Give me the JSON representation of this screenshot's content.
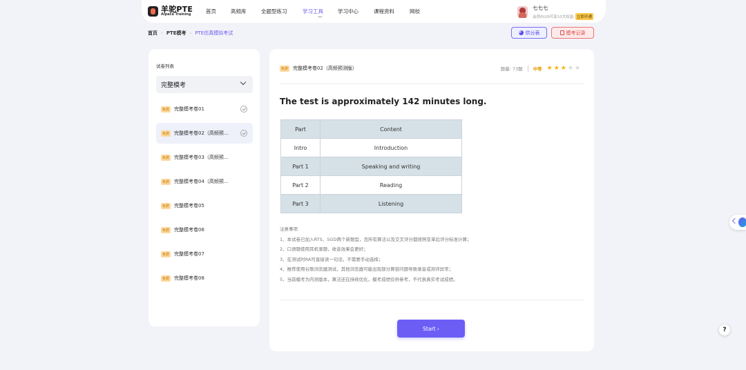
{
  "brand": {
    "title": "羊驼PTE",
    "subtitle": "Alpaca Training"
  },
  "nav": [
    {
      "label": "首页"
    },
    {
      "label": "高频库"
    },
    {
      "label": "全题型练习"
    },
    {
      "label": "学习工具",
      "active": true
    },
    {
      "label": "学习中心"
    },
    {
      "label": "课程资料"
    },
    {
      "label": "网校"
    }
  ],
  "user": {
    "name": "七七七",
    "plus_text": "会员PLUS可享10大权益",
    "open_button": "立即开通"
  },
  "breadcrumb": {
    "home": "首页",
    "section": "PTE模考",
    "current": "PTE仿真模拟考试"
  },
  "actions": {
    "score_table": "供分表",
    "exam_record": "模考记录"
  },
  "sidebar": {
    "title": "试卷列表",
    "select_value": "完整模考",
    "papers": [
      {
        "tag": "免费",
        "label": "完整模考卷01",
        "done": true
      },
      {
        "tag": "免费",
        "label": "完整模考卷02（高频预...",
        "done": true,
        "selected": true
      },
      {
        "tag": "免费",
        "label": "完整模考卷03（高频预..."
      },
      {
        "tag": "免费",
        "label": "完整模考卷04（高频预..."
      },
      {
        "tag": "免费",
        "label": "完整模考卷05"
      },
      {
        "tag": "免费",
        "label": "完整模考卷06"
      },
      {
        "tag": "免费",
        "label": "完整模考卷07"
      },
      {
        "tag": "免费",
        "label": "完整模考卷08"
      }
    ]
  },
  "main": {
    "tag": "免费",
    "paper_title": "完整模考卷02（高频预测版）",
    "question_count": "题量: 73题",
    "level": "中等",
    "rating": {
      "value": 3,
      "max": 5
    },
    "headline": "The test is approximately 142 minutes long.",
    "table": {
      "headers": [
        "Part",
        "Content"
      ],
      "rows": [
        [
          "Intro",
          "Introduction"
        ],
        [
          "Part 1",
          "Speaking and writing"
        ],
        [
          "Part 2",
          "Reading"
        ],
        [
          "Part 3",
          "Listening"
        ]
      ]
    },
    "notes_title": "注意事项",
    "notes": [
      "1、本试卷已加入RTS、SGD两个新题型，且所有算法以及交叉评分都按照变革后评分标准计算；",
      "2、口语题使用耳机录题，收音效果会更好；",
      "3、在测试时RA可直接读一句话，不需要手动选择；",
      "4、推荐使用谷歌浏览器测试，其他浏览器可能出现部分算容问题导致录音或测评异常；",
      "5、当前模考为内测版本，算法还在持续优化，模考成绩仅供参考，不代表真实考试成绩。"
    ],
    "start_button": "Start"
  },
  "help_label": "?"
}
